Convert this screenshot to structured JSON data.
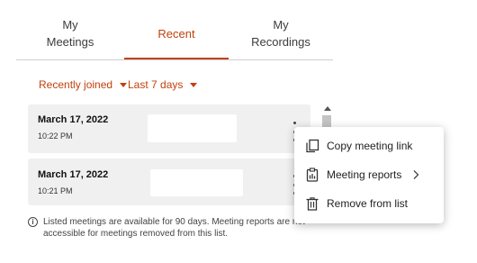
{
  "tabs": [
    {
      "line1": "My",
      "line2": "Meetings"
    },
    {
      "line1": "Recent",
      "line2": ""
    },
    {
      "line1": "My",
      "line2": "Recordings"
    }
  ],
  "active_tab": "Recent",
  "filters": {
    "type": "Recently joined",
    "range": "Last 7 days"
  },
  "meetings": [
    {
      "date": "March 17, 2022",
      "time": "10:22 PM"
    },
    {
      "date": "March 17, 2022",
      "time": "10:21 PM"
    }
  ],
  "info": {
    "text": "Listed meetings are available for 90 days. Meeting reports are not accessible for meetings removed from this list.",
    "icon": "info-icon"
  },
  "context_menu": {
    "items": [
      {
        "label": "Copy meeting link",
        "icon": "copy-icon"
      },
      {
        "label": "Meeting reports",
        "icon": "report-icon",
        "has_submenu": true
      },
      {
        "label": "Remove from list",
        "icon": "trash-icon"
      }
    ]
  },
  "colors": {
    "accent": "#c2410c",
    "card_bg": "#f0f0f0"
  }
}
